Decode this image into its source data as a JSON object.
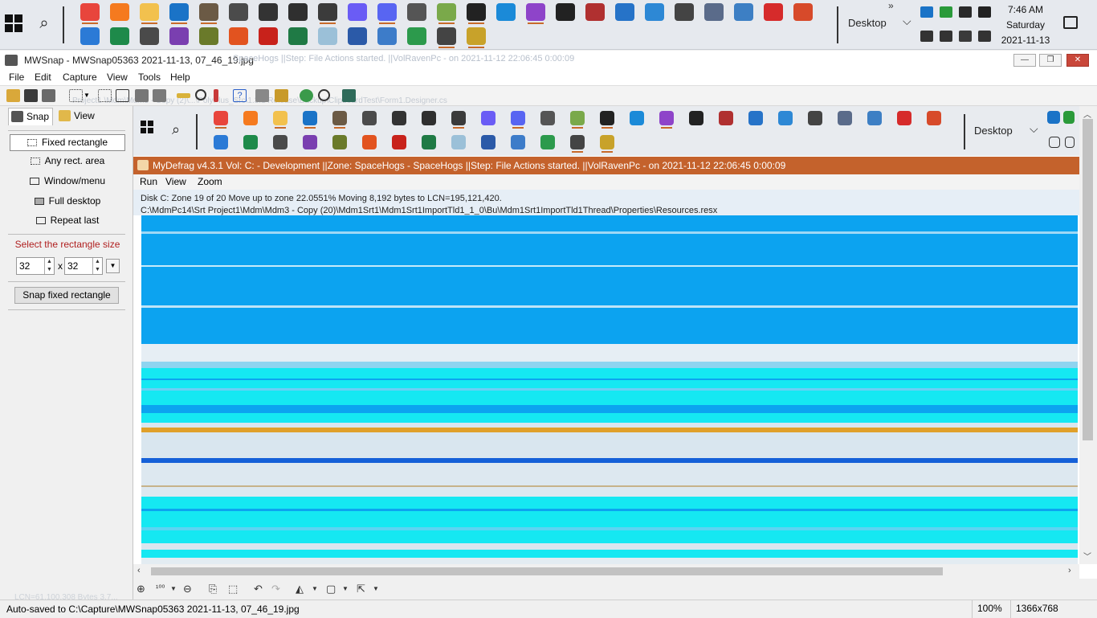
{
  "taskbar": {
    "desktop_label": "Desktop",
    "more_label": "»",
    "clock": {
      "time": "7:46 AM",
      "day": "Saturday",
      "date": "2021-11-13"
    },
    "pinned_row1": [
      {
        "icon": "chrome-icon",
        "color": "#e8453c",
        "running": true
      },
      {
        "icon": "firefox-icon",
        "color": "#f57a1f",
        "running": false
      },
      {
        "icon": "file-explorer-icon",
        "color": "#f2c14e",
        "running": true
      },
      {
        "icon": "outlook-icon",
        "color": "#1a73c7",
        "running": true
      },
      {
        "icon": "gimp-icon",
        "color": "#6b5a45",
        "running": true
      },
      {
        "icon": "app-icon",
        "color": "#4b4b4b",
        "running": false
      },
      {
        "icon": "app-icon",
        "color": "#333333",
        "running": false
      },
      {
        "icon": "camera-icon",
        "color": "#2f2f2f",
        "running": false
      },
      {
        "icon": "calendar-icon",
        "color": "#3b3b3b",
        "running": true
      },
      {
        "icon": "messenger-icon",
        "color": "#6a5cf5",
        "running": false
      },
      {
        "icon": "discord-icon",
        "color": "#5865f2",
        "running": true
      },
      {
        "icon": "checklist-icon",
        "color": "#555555",
        "running": false
      },
      {
        "icon": "tool-icon",
        "color": "#7aa94a",
        "running": true
      },
      {
        "icon": "terminal-icon",
        "color": "#222222",
        "running": true
      },
      {
        "icon": "vscode-icon",
        "color": "#1b8ad8",
        "running": false
      },
      {
        "icon": "visual-studio-icon",
        "color": "#8e44c9",
        "running": true
      },
      {
        "icon": "terminal-icon",
        "color": "#222222",
        "running": false
      },
      {
        "icon": "app-icon",
        "color": "#b03030",
        "running": false
      },
      {
        "icon": "powershell-icon",
        "color": "#2673c8",
        "running": false
      },
      {
        "icon": "grid-icon",
        "color": "#2d88d5",
        "running": false
      },
      {
        "icon": "gear-icon",
        "color": "#444444",
        "running": false
      },
      {
        "icon": "network-icon",
        "color": "#5a6b8a",
        "running": false
      },
      {
        "icon": "display-icon",
        "color": "#3d7fc4",
        "running": false
      },
      {
        "icon": "acrobat-icon",
        "color": "#d62b2b",
        "running": false
      },
      {
        "icon": "pdf-icon",
        "color": "#d74a2a",
        "running": false
      }
    ],
    "pinned_row2": [
      {
        "icon": "todo-icon",
        "color": "#2b7ad6",
        "running": false
      },
      {
        "icon": "app-icon",
        "color": "#1e8a4a",
        "running": false
      },
      {
        "icon": "app-icon",
        "color": "#4a4a4a",
        "running": false
      },
      {
        "icon": "app-icon",
        "color": "#7a3fb0",
        "running": false
      },
      {
        "icon": "palm-icon",
        "color": "#6a7a2a",
        "running": false
      },
      {
        "icon": "office-icon",
        "color": "#e2531f",
        "running": false
      },
      {
        "icon": "acrobat-icon",
        "color": "#c8221b",
        "running": false
      },
      {
        "icon": "excel-icon",
        "color": "#1f7a45",
        "running": false
      },
      {
        "icon": "notes-icon",
        "color": "#9bc0d8",
        "running": false
      },
      {
        "icon": "word-icon",
        "color": "#2b5aa8",
        "running": false
      },
      {
        "icon": "document-icon",
        "color": "#3d7cc9",
        "running": false
      },
      {
        "icon": "sheet-icon",
        "color": "#2c9a4c",
        "running": false
      },
      {
        "icon": "notepad-icon",
        "color": "#444444",
        "running": true
      },
      {
        "icon": "myo-icon",
        "color": "#c8a22a",
        "running": true
      }
    ],
    "tray_row1": [
      {
        "icon": "outlook-tray-icon",
        "color": "#1a73c7"
      },
      {
        "icon": "shield-icon",
        "color": "#2a9a3a"
      },
      {
        "icon": "battery-icon",
        "color": "#2a2a2a"
      },
      {
        "icon": "microphone-icon",
        "color": "#222222"
      }
    ],
    "tray_row2": [
      {
        "icon": "network-tray-icon",
        "color": "#333333"
      },
      {
        "icon": "volume-icon",
        "color": "#333333"
      },
      {
        "icon": "calendar-tray-icon",
        "color": "#3a3a3a"
      },
      {
        "icon": "camera-tray-icon",
        "color": "#333333"
      }
    ]
  },
  "window": {
    "title": "MWSnap - MWSnap05363 2021-11-13, 07_46_19.jpg",
    "ghost_title": "SpaceHogs ||Step: File Actions started. ||VolRavenPc - on 2021-11-12 22:06:45 0:00:09",
    "min_label": "—",
    "max_label": "❐",
    "close_label": "✕"
  },
  "menu": [
    "File",
    "Edit",
    "Capture",
    "View",
    "Tools",
    "Help"
  ],
  "toolbar_ghost_text": "Project1 \\Mdm\\Mdm3 - Copy (2)\\...\\PolyPlus_Src\\1.3.1 Release\\Backup\\ClipboardTest\\Form1.Designer.cs",
  "left_panel": {
    "tabs": [
      {
        "label": "Snap",
        "icon": "camera-icon"
      },
      {
        "label": "View",
        "icon": "folder-icon"
      }
    ],
    "options": [
      {
        "label": "Fixed rectangle",
        "selected": true
      },
      {
        "label": "Any rect. area",
        "selected": false
      },
      {
        "label": "Window/menu",
        "selected": false
      },
      {
        "label": "Full desktop",
        "selected": false
      },
      {
        "label": "Repeat last",
        "selected": false
      }
    ],
    "size_label": "Select the rectangle size",
    "width_value": "32",
    "height_value": "32",
    "times_symbol": "x",
    "snap_button": "Snap fixed rectangle",
    "ghost_text": "LCN=61,100,308 Bytes 3,7..."
  },
  "captured": {
    "desktop_label": "Desktop",
    "title": "MyDefrag v4.3.1    Vol: C: - Development ||Zone: SpaceHogs - SpaceHogs ||Step: File Actions started. ||VolRavenPc -  on 2021-11-12 22:06:45 0:00:09",
    "menu": [
      "Run",
      "View",
      "Zoom"
    ],
    "status_line1": "Disk C:   Zone 19 of 20   Move up to zone   22.0551%   Moving 8,192 bytes to LCN=195,121,420.",
    "status_line2": "C:\\MdmPc14\\Srt Project1\\Mdm\\Mdm3 - Copy (20)\\Mdm1Srt1\\Mdm1Srt1ImportTld1_1_0\\Bu\\Mdm1Srt1ImportTld1Thread\\Properties\\Resources.resx",
    "disk_colors": {
      "blue": "#0ca3f0",
      "cyan": "#15e8f2",
      "light": "#d9e6ef",
      "orange": "#e0a02a",
      "dark_blue": "#1560d8"
    }
  },
  "bottom_tools": [
    "⊕",
    "¹⁰⁰",
    "⊖",
    "⎘",
    "⬚",
    "↶",
    "↷",
    "◭",
    "▢",
    "⇱"
  ],
  "status": {
    "text": "Auto-saved to C:\\Capture\\MWSnap05363 2021-11-13, 07_46_19.jpg",
    "zoom": "100%",
    "size": "1366x768"
  }
}
